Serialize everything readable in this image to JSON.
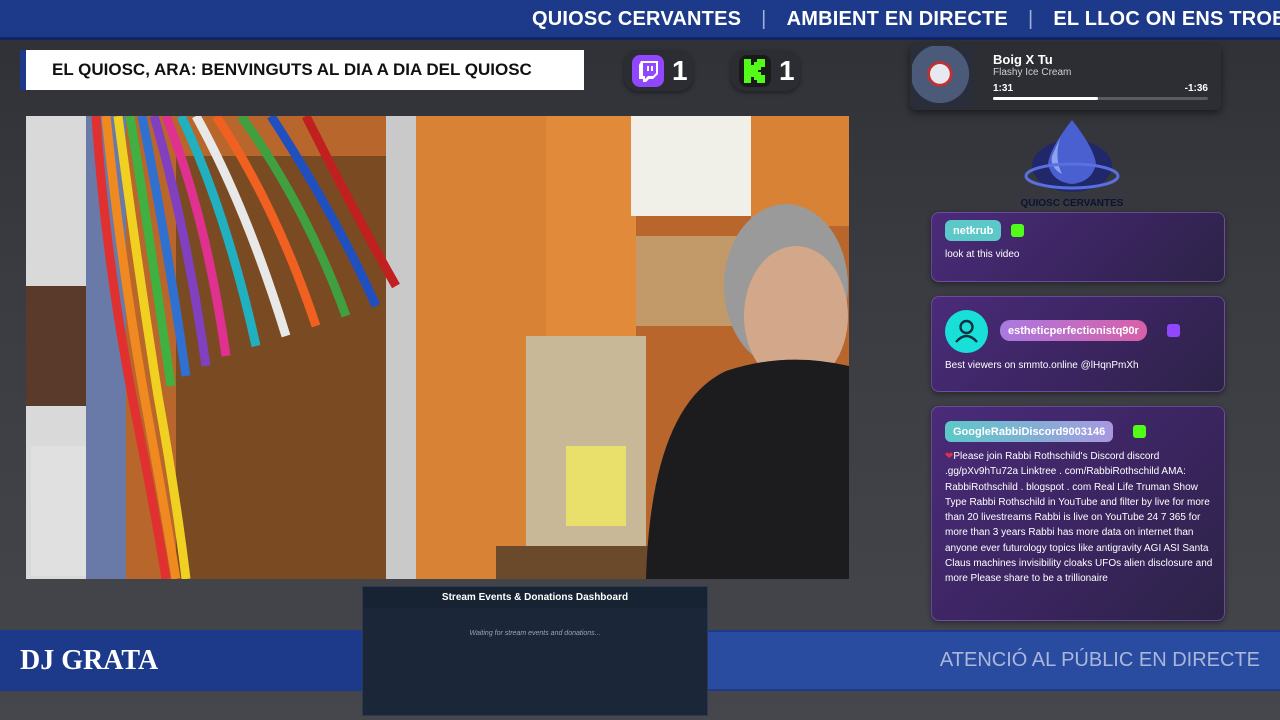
{
  "ticker": {
    "items": [
      "QUIOSC CERVANTES",
      "AMBIENT EN DIRECTE",
      "EL LLOC ON ENS TROB"
    ],
    "separator": "|"
  },
  "title_bar": {
    "text": "EL QUIOSC, ARA: BENVINGUTS AL DIA A DIA DEL QUIOSC"
  },
  "counters": [
    {
      "platform": "twitch-icon",
      "count": "1"
    },
    {
      "platform": "kick-icon",
      "count": "1"
    }
  ],
  "now_playing": {
    "title": "Boig X Tu",
    "artist": "Flashy Ice Cream",
    "elapsed": "1:31",
    "remaining": "-1:36",
    "progress": 0.49
  },
  "logo": {
    "text": "QUIOSC CERVANTES"
  },
  "chat": [
    {
      "username": "netkrub",
      "message": "look at this video",
      "platform": "kick"
    },
    {
      "username": "estheticperfectionistq90r",
      "message": "Best viewers on smmto.online @lHqnPmXh",
      "platform": "twitch"
    },
    {
      "username": "GoogleRabbiDiscord9003146",
      "heart": "❤",
      "message": "Please join Rabbi Rothschild's Discord discord .gg/pXv9hTu72a Linktree . com/RabbiRothschild AMA: RabbiRothschild . blogspot . com Real Life Truman Show Type Rabbi Rothschild in YouTube and filter by live for more than 20 livestreams Rabbi is live on YouTube 24 7 365 for more than 3 years Rabbi has more data on internet than anyone ever futurology topics like antigravity AGI ASI Santa Claus machines invisibility cloaks UFOs alien disclosure and more Please share to be a trillionaire",
      "platform": "kick"
    }
  ],
  "footer": {
    "dj_name": "DJ GRATA",
    "right_text": "ATENCIÓ AL PÚBLIC EN DIRECTE"
  },
  "dashboard": {
    "title": "Stream Events & Donations Dashboard",
    "status": "Waiting for stream events and donations..."
  },
  "colors": {
    "brand_blue": "#1d3a8a",
    "twitch": "#9146ff",
    "kick": "#53fc18",
    "chat_card": "#4a2b7a"
  }
}
